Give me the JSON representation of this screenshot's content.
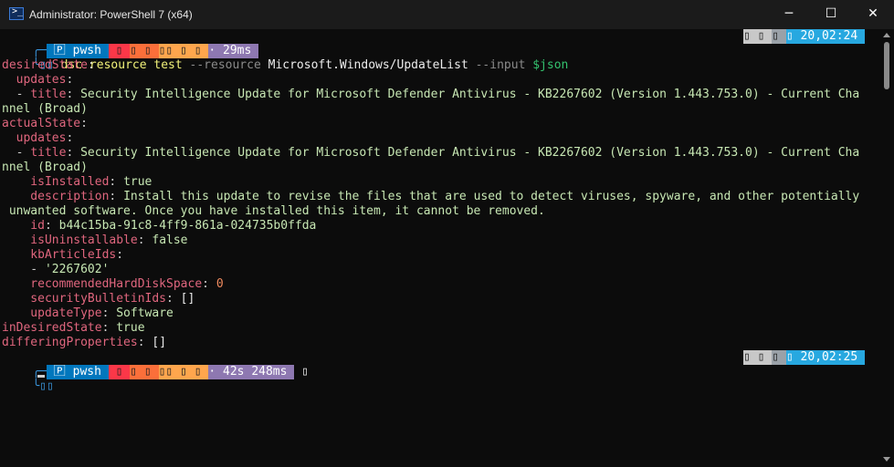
{
  "window": {
    "title": "Administrator: PowerShell 7 (x64)",
    "app_icon_glyph": ">_",
    "min_glyph": "─",
    "max_glyph": "☐",
    "close_glyph": "✕"
  },
  "prompt1": {
    "corner": "╭─",
    "segments": [
      {
        "cls": "s-pwsh",
        "text": " 🄿 pwsh "
      },
      {
        "cls": "s-git1",
        "text": " ▯ "
      },
      {
        "cls": "s-git2",
        "text": "▯ ▯ "
      },
      {
        "cls": "s-git3",
        "text": "▯▯ ▯ ▯ "
      },
      {
        "cls": "s-dur",
        "text": "· 29ms "
      }
    ],
    "right": [
      {
        "cls": "s-gray",
        "text": "▯ ▯ "
      },
      {
        "cls": "s-gray2",
        "text": "▯ "
      },
      {
        "cls": "s-time",
        "text": "▯ 20,02:24 "
      }
    ]
  },
  "command": {
    "prefix": "╰▯▯ ",
    "cmd": "dsc resource test",
    "p1": "--resource",
    "a1": "Microsoft.Windows/UpdateList",
    "p2": "--input",
    "var": "$json"
  },
  "output": [
    [
      {
        "c": "c-key",
        "t": "desiredState"
      },
      {
        "c": "c-dash",
        "t": ":"
      }
    ],
    [
      {
        "c": "c-key",
        "t": "  updates"
      },
      {
        "c": "c-dash",
        "t": ":"
      }
    ],
    [
      {
        "c": "c-dash",
        "t": "  - "
      },
      {
        "c": "c-key",
        "t": "title"
      },
      {
        "c": "c-dash",
        "t": ": "
      },
      {
        "c": "c-val",
        "t": "Security Intelligence Update for Microsoft Defender Antivirus - KB2267602 (Version 1.443.753.0) - Current Cha"
      }
    ],
    [
      {
        "c": "c-val",
        "t": "nnel (Broad)"
      }
    ],
    [
      {
        "c": "c-key",
        "t": "actualState"
      },
      {
        "c": "c-dash",
        "t": ":"
      }
    ],
    [
      {
        "c": "c-key",
        "t": "  updates"
      },
      {
        "c": "c-dash",
        "t": ":"
      }
    ],
    [
      {
        "c": "c-dash",
        "t": "  - "
      },
      {
        "c": "c-key",
        "t": "title"
      },
      {
        "c": "c-dash",
        "t": ": "
      },
      {
        "c": "c-val",
        "t": "Security Intelligence Update for Microsoft Defender Antivirus - KB2267602 (Version 1.443.753.0) - Current Cha"
      }
    ],
    [
      {
        "c": "c-val",
        "t": "nnel (Broad)"
      }
    ],
    [
      {
        "c": "c-key",
        "t": "    isInstalled"
      },
      {
        "c": "c-dash",
        "t": ": "
      },
      {
        "c": "c-bool",
        "t": "true"
      }
    ],
    [
      {
        "c": "c-key",
        "t": "    description"
      },
      {
        "c": "c-dash",
        "t": ": "
      },
      {
        "c": "c-val",
        "t": "Install this update to revise the files that are used to detect viruses, spyware, and other potentially"
      }
    ],
    [
      {
        "c": "c-val",
        "t": " unwanted software. Once you have installed this item, it cannot be removed."
      }
    ],
    [
      {
        "c": "c-key",
        "t": "    id"
      },
      {
        "c": "c-dash",
        "t": ": "
      },
      {
        "c": "c-val",
        "t": "b44c15ba-91c8-4ff9-861a-024735b0ffda"
      }
    ],
    [
      {
        "c": "c-key",
        "t": "    isUninstallable"
      },
      {
        "c": "c-dash",
        "t": ": "
      },
      {
        "c": "c-bool",
        "t": "false"
      }
    ],
    [
      {
        "c": "c-key",
        "t": "    kbArticleIds"
      },
      {
        "c": "c-dash",
        "t": ":"
      }
    ],
    [
      {
        "c": "c-dash",
        "t": "    - "
      },
      {
        "c": "c-val",
        "t": "'2267602'"
      }
    ],
    [
      {
        "c": "c-key",
        "t": "    recommendedHardDiskSpace"
      },
      {
        "c": "c-dash",
        "t": ": "
      },
      {
        "c": "c-num",
        "t": "0"
      }
    ],
    [
      {
        "c": "c-key",
        "t": "    securityBulletinIds"
      },
      {
        "c": "c-dash",
        "t": ": "
      },
      {
        "c": "c-white",
        "t": "[]"
      }
    ],
    [
      {
        "c": "c-key",
        "t": "    updateType"
      },
      {
        "c": "c-dash",
        "t": ": "
      },
      {
        "c": "c-val",
        "t": "Software"
      }
    ],
    [
      {
        "c": "c-key",
        "t": "inDesiredState"
      },
      {
        "c": "c-dash",
        "t": ": "
      },
      {
        "c": "c-bool",
        "t": "true"
      }
    ],
    [
      {
        "c": "c-key",
        "t": "differingProperties"
      },
      {
        "c": "c-dash",
        "t": ": "
      },
      {
        "c": "c-white",
        "t": "[]"
      }
    ]
  ],
  "prompt2": {
    "corner": "╭─",
    "segments": [
      {
        "cls": "s-pwsh",
        "text": " 🄿 pwsh "
      },
      {
        "cls": "s-git1",
        "text": " ▯ "
      },
      {
        "cls": "s-git2",
        "text": "▯ ▯ "
      },
      {
        "cls": "s-git3",
        "text": "▯▯ ▯ ▯ "
      },
      {
        "cls": "s-dur",
        "text": "· 42s 248ms "
      }
    ],
    "tail": " ▯",
    "right": [
      {
        "cls": "s-gray",
        "text": "▯ ▯ "
      },
      {
        "cls": "s-gray2",
        "text": "▯ "
      },
      {
        "cls": "s-time",
        "text": "▯ 20,02:25 "
      }
    ]
  },
  "prompt2_line2": "╰▯▯ "
}
